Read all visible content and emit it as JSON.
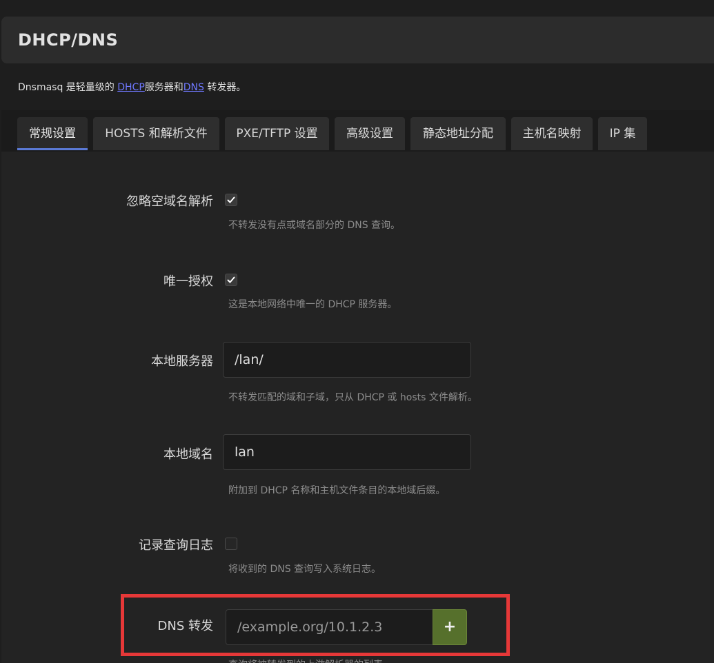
{
  "header": {
    "title": "DHCP/DNS"
  },
  "description": {
    "prefix": "Dnsmasq 是轻量级的 ",
    "dhcp_link": "DHCP",
    "middle": "服务器和",
    "dns_link": "DNS",
    "suffix": " 转发器。"
  },
  "tabs": [
    {
      "label": "常规设置",
      "active": true
    },
    {
      "label": "HOSTS 和解析文件",
      "active": false
    },
    {
      "label": "PXE/TFTP 设置",
      "active": false
    },
    {
      "label": "高级设置",
      "active": false
    },
    {
      "label": "静态地址分配",
      "active": false
    },
    {
      "label": "主机名映射",
      "active": false
    },
    {
      "label": "IP 集",
      "active": false
    }
  ],
  "fields": {
    "domain_needed": {
      "label": "忽略空域名解析",
      "checked": true,
      "help": "不转发没有点或域名部分的 DNS 查询。"
    },
    "authoritative": {
      "label": "唯一授权",
      "checked": true,
      "help": "这是本地网络中唯一的 DHCP 服务器。"
    },
    "local_server": {
      "label": "本地服务器",
      "value": "/lan/",
      "help": "不转发匹配的域和子域，只从 DHCP 或 hosts 文件解析。"
    },
    "local_domain": {
      "label": "本地域名",
      "value": "lan",
      "help": "附加到 DHCP 名称和主机文件条目的本地域后缀。"
    },
    "log_queries": {
      "label": "记录查询日志",
      "checked": false,
      "help": "将收到的 DNS 查询写入系统日志。"
    },
    "dns_forward": {
      "label": "DNS 转发",
      "placeholder": "/example.org/10.1.2.3",
      "add_label": "+",
      "help_partial": "查询将被转发到的上游解析器的列表"
    }
  },
  "colors": {
    "accent_tab": "#5b7ad6",
    "add_button": "#56702c",
    "highlight": "#e63838",
    "link": "#6f78ff"
  }
}
